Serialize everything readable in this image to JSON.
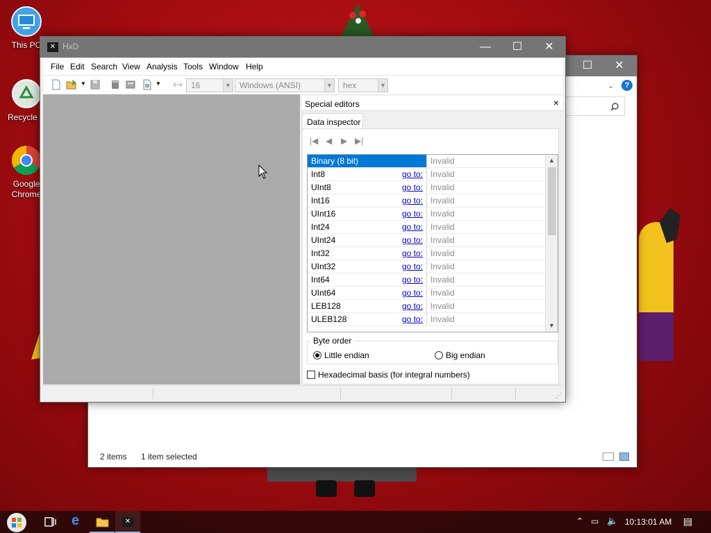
{
  "desktop": {
    "icons": [
      {
        "label": "This PC"
      },
      {
        "label": "Recycle B"
      },
      {
        "label": "Google Chrome"
      }
    ]
  },
  "explorer": {
    "status_items": "2 items",
    "status_selected": "1 item selected"
  },
  "hxd": {
    "title": "HxD",
    "menu": [
      "File",
      "Edit",
      "Search",
      "View",
      "Analysis",
      "Tools",
      "Window",
      "Help"
    ],
    "toolbar": {
      "bytes_per_row": "16",
      "charset": "Windows (ANSI)",
      "offset_base": "hex"
    },
    "panel": {
      "title": "Special editors",
      "close": "×",
      "tab": "Data inspector",
      "rows": [
        {
          "name": "Binary (8 bit)",
          "goto": "",
          "value": "Invalid",
          "selected": true
        },
        {
          "name": "Int8",
          "goto": "go to:",
          "value": "Invalid"
        },
        {
          "name": "UInt8",
          "goto": "go to:",
          "value": "Invalid"
        },
        {
          "name": "Int16",
          "goto": "go to:",
          "value": "Invalid"
        },
        {
          "name": "UInt16",
          "goto": "go to:",
          "value": "Invalid"
        },
        {
          "name": "Int24",
          "goto": "go to:",
          "value": "Invalid"
        },
        {
          "name": "UInt24",
          "goto": "go to:",
          "value": "Invalid"
        },
        {
          "name": "Int32",
          "goto": "go to:",
          "value": "Invalid"
        },
        {
          "name": "UInt32",
          "goto": "go to:",
          "value": "Invalid"
        },
        {
          "name": "Int64",
          "goto": "go to:",
          "value": "Invalid"
        },
        {
          "name": "UInt64",
          "goto": "go to:",
          "value": "Invalid"
        },
        {
          "name": "LEB128",
          "goto": "go to:",
          "value": "Invalid"
        },
        {
          "name": "ULEB128",
          "goto": "go to:",
          "value": "Invalid"
        }
      ],
      "byte_order_label": "Byte order",
      "little_endian": "Little endian",
      "big_endian": "Big endian",
      "byte_order_selected": "Little endian",
      "hex_basis": "Hexadecimal basis (for integral numbers)",
      "hex_basis_checked": false
    }
  },
  "taskbar": {
    "time": "10:13:01 AM",
    "items": [
      "start-icon",
      "task-view-icon",
      "edge-icon",
      "file-explorer-icon",
      "hxd-icon"
    ]
  },
  "colors": {
    "selection": "#0078d7",
    "link": "#0000c8",
    "desktop": "#a30c10"
  }
}
